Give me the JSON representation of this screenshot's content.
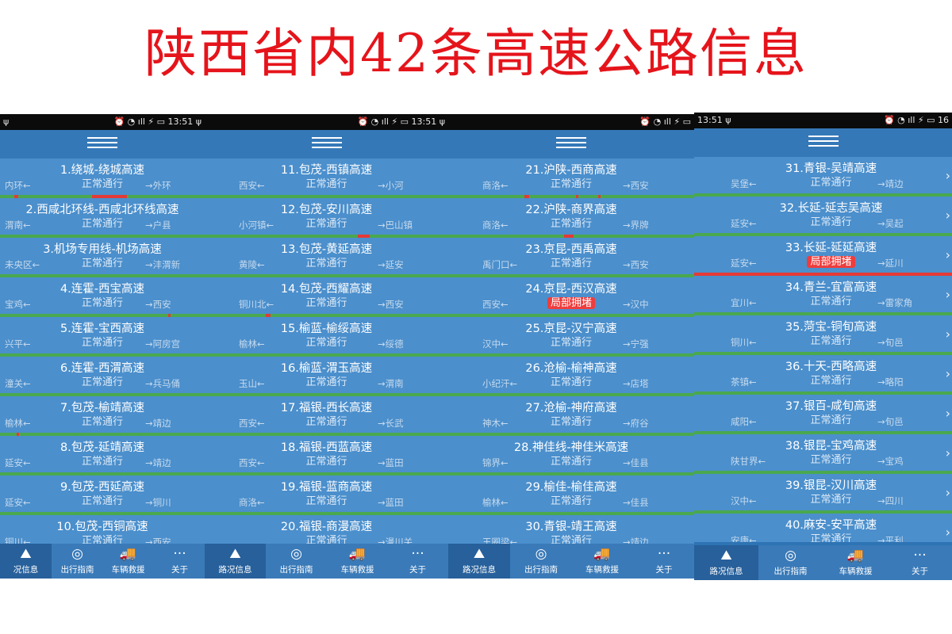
{
  "title": "陕西省内42条高速公路信息",
  "screens": [
    {
      "status_left": "ψ",
      "status_right": "⏰ ◔ ıll ⚡ ▭ 13:51 ψ",
      "routes": [
        {
          "name": "1.绕城-绕城高速",
          "status": "正常通行",
          "from": "内环←",
          "to": "→外环",
          "jam": [
            [
              0.45,
              0.62
            ],
            [
              0.07,
              0.09
            ]
          ]
        },
        {
          "name": "2.西咸北环线-西咸北环线高速",
          "status": "正常通行",
          "from": "渭南←",
          "to": "→户县",
          "jam": []
        },
        {
          "name": "3.机场专用线-机场高速",
          "status": "正常通行",
          "from": "未央区←",
          "to": "→沣渭新",
          "jam": []
        },
        {
          "name": "4.连霍-西宝高速",
          "status": "正常通行",
          "from": "宝鸡←",
          "to": "→西安",
          "jam": [
            [
              0.82,
              0.83
            ]
          ]
        },
        {
          "name": "5.连霍-宝西高速",
          "status": "正常通行",
          "from": "兴平←",
          "to": "→阿房宫",
          "jam": []
        },
        {
          "name": "6.连霍-西渭高速",
          "status": "正常通行",
          "from": "潼关←",
          "to": "→兵马俑",
          "jam": []
        },
        {
          "name": "7.包茂-榆靖高速",
          "status": "正常通行",
          "from": "榆林←",
          "to": "→靖边",
          "jam": [
            [
              0.08,
              0.09
            ]
          ]
        },
        {
          "name": "8.包茂-延靖高速",
          "status": "正常通行",
          "from": "延安←",
          "to": "→靖边",
          "jam": []
        },
        {
          "name": "9.包茂-西延高速",
          "status": "正常通行",
          "from": "延安←",
          "to": "→铜川",
          "jam": []
        },
        {
          "name": "10.包茂-西铜高速",
          "status": "正常通行",
          "from": "铜川←",
          "to": "→西安",
          "jam": []
        }
      ],
      "tabs": [
        "况信息",
        "出行指南",
        "车辆救援",
        "关于"
      ]
    },
    {
      "status_left": "",
      "status_right": "⏰ ◔ ıll ⚡ ▭ 13:51 ψ",
      "routes": [
        {
          "name": "11.包茂-西镇高速",
          "status": "正常通行",
          "from": "西安←",
          "to": "→小河",
          "jam": []
        },
        {
          "name": "12.包茂-安川高速",
          "status": "正常通行",
          "from": "小河镇←",
          "to": "→巴山镇",
          "jam": [
            [
              0.63,
              0.68
            ]
          ]
        },
        {
          "name": "13.包茂-黄延高速",
          "status": "正常通行",
          "from": "黄陵←",
          "to": "→延安",
          "jam": []
        },
        {
          "name": "14.包茂-西耀高速",
          "status": "正常通行",
          "from": "铜川北←",
          "to": "→西安",
          "jam": [
            [
              0.25,
              0.27
            ]
          ]
        },
        {
          "name": "15.榆蓝-榆绥高速",
          "status": "正常通行",
          "from": "榆林←",
          "to": "→绥德",
          "jam": []
        },
        {
          "name": "16.榆蓝-渭玉高速",
          "status": "正常通行",
          "from": "玉山←",
          "to": "→渭南",
          "jam": []
        },
        {
          "name": "17.福银-西长高速",
          "status": "正常通行",
          "from": "西安←",
          "to": "→长武",
          "jam": []
        },
        {
          "name": "18.福银-西蓝高速",
          "status": "正常通行",
          "from": "西安←",
          "to": "→蓝田",
          "jam": []
        },
        {
          "name": "19.福银-蓝商高速",
          "status": "正常通行",
          "from": "商洛←",
          "to": "→蓝田",
          "jam": []
        },
        {
          "name": "20.福银-商漫高速",
          "status": "正常通行",
          "from": "",
          "to": "→漫川关",
          "jam": []
        }
      ],
      "tabs": [
        "路况信息",
        "出行指南",
        "车辆救援",
        "关于"
      ]
    },
    {
      "status_left": "",
      "status_right": "⏰ ◔ ıll ⚡ ▭",
      "routes": [
        {
          "name": "21.沪陕-西商高速",
          "status": "正常通行",
          "from": "商洛←",
          "to": "→西安",
          "jam": [
            [
              0.31,
              0.33
            ],
            [
              0.52,
              0.53
            ],
            [
              0.61,
              0.62
            ]
          ]
        },
        {
          "name": "22.沪陕-商界高速",
          "status": "正常通行",
          "from": "商洛←",
          "to": "→界牌",
          "jam": [
            [
              0.47,
              0.51
            ]
          ]
        },
        {
          "name": "23.京昆-西禹高速",
          "status": "正常通行",
          "from": "禹门口←",
          "to": "→西安",
          "jam": []
        },
        {
          "name": "24.京昆-西汉高速",
          "status": "局部拥堵",
          "from": "西安←",
          "to": "→汉中",
          "jam": []
        },
        {
          "name": "25.京昆-汉宁高速",
          "status": "正常通行",
          "from": "汉中←",
          "to": "→宁强",
          "jam": []
        },
        {
          "name": "26.沧榆-榆神高速",
          "status": "正常通行",
          "from": "小纪汗←",
          "to": "→店塔",
          "jam": []
        },
        {
          "name": "27.沧榆-神府高速",
          "status": "正常通行",
          "from": "神木←",
          "to": "→府谷",
          "jam": []
        },
        {
          "name": "28.神佳线-神佳米高速",
          "status": "正常通行",
          "from": "锦界←",
          "to": "→佳县",
          "jam": []
        },
        {
          "name": "29.榆佳-榆佳高速",
          "status": "正常通行",
          "from": "榆林←",
          "to": "→佳县",
          "jam": []
        },
        {
          "name": "30.青银-靖王高速",
          "status": "正常通行",
          "from": "王圈梁←",
          "to": "→靖边",
          "jam": []
        }
      ],
      "tabs": [
        "路况信息",
        "出行指南",
        "车辆救援",
        "关于"
      ]
    },
    {
      "status_left": "13:51 ψ",
      "status_right": "⏰ ◔ ıll ⚡ ▭ 16",
      "routes": [
        {
          "name": "31.青银-吴靖高速",
          "status": "正常通行",
          "from": "吴堡←",
          "to": "→靖边",
          "jam": []
        },
        {
          "name": "32.长延-延志吴高速",
          "status": "正常通行",
          "from": "延安←",
          "to": "→吴起",
          "jam": []
        },
        {
          "name": "33.长延-延延高速",
          "status": "局部拥堵",
          "from": "延安←",
          "to": "→延川",
          "jam": [
            [
              0.0,
              1.0
            ]
          ]
        },
        {
          "name": "34.青兰-宜富高速",
          "status": "正常通行",
          "from": "宜川←",
          "to": "→雷家角",
          "jam": []
        },
        {
          "name": "35.菏宝-铜旬高速",
          "status": "正常通行",
          "from": "铜川←",
          "to": "→旬邑",
          "jam": []
        },
        {
          "name": "36.十天-西略高速",
          "status": "正常通行",
          "from": "茶镇←",
          "to": "→略阳",
          "jam": []
        },
        {
          "name": "37.银百-咸旬高速",
          "status": "正常通行",
          "from": "咸阳←",
          "to": "→旬邑",
          "jam": []
        },
        {
          "name": "38.银昆-宝鸡高速",
          "status": "正常通行",
          "from": "陕甘界←",
          "to": "→宝鸡",
          "jam": []
        },
        {
          "name": "39.银昆-汉川高速",
          "status": "正常通行",
          "from": "汉中←",
          "to": "→四川",
          "jam": []
        },
        {
          "name": "40.麻安-安平高速",
          "status": "正常通行",
          "from": "安康←",
          "to": "→平利",
          "jam": []
        }
      ],
      "tabs": [
        "路况信息",
        "出行指南",
        "车辆救援",
        "关于"
      ]
    }
  ],
  "colors": {
    "title": "#e5141b",
    "jam": "#e53935",
    "normal_line": "#4aa84e",
    "row_bg": "#4b8fcc",
    "panel": "#2e74b4"
  },
  "icons": [
    "map-icon",
    "compass-icon",
    "tow-truck-icon",
    "more-icon",
    "menu-icon",
    "chevron-right-icon"
  ]
}
